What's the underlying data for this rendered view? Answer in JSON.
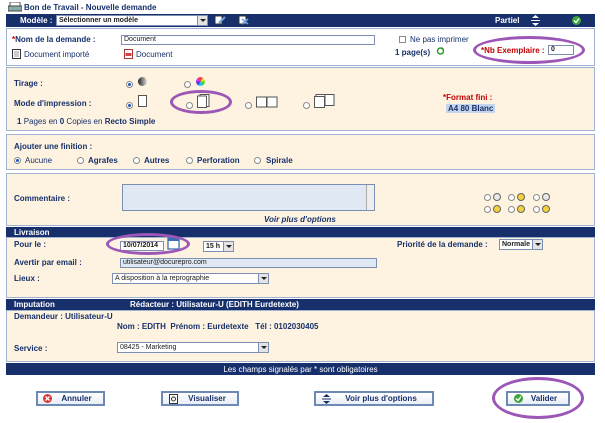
{
  "header": {
    "title": "Bon de Travail - Nouvelle demande",
    "modele_label": "Modèle :",
    "modele_value": "Sélectionner un modèle",
    "partiel_label": "Partiel"
  },
  "demande": {
    "nom_label": "Nom de la demande :",
    "nom_value": "Document",
    "ne_pas_imprimer_label": "Ne pas imprimer",
    "nb_exemplaire_label": "*Nb Exemplaire :",
    "nb_exemplaire_value": "0",
    "document_importe": "Document importé",
    "document_link": "Document",
    "pages": "1 page(s)"
  },
  "impression": {
    "tirage_label": "Tirage :",
    "mode_label": "Mode d'impression :",
    "format_fini_label": "*Format fini :",
    "format_fini_value": "A4 80 Blanc",
    "summary": {
      "pages_count": "1",
      "pages_text": "Pages en",
      "copies_count": "0",
      "copies_text": "Copies en",
      "mode": "Recto Simple"
    }
  },
  "finition": {
    "title": "Ajouter une finition :",
    "options": [
      "Aucune",
      "Agrafes",
      "Autres",
      "Perforation",
      "Spirale"
    ]
  },
  "commentaire": {
    "label": "Commentaire :",
    "voir_plus": "Voir plus d'options"
  },
  "livraison": {
    "title": "Livraison",
    "pour_le_label": "Pour le :",
    "date_value": "10/07/2014",
    "heure_value": "15 h",
    "priorite_label": "Priorité de la demande :",
    "priorite_value": "Normale",
    "avertir_label": "Avertir par email :",
    "email_value": "utilisateur@docurepro.com",
    "lieux_label": "Lieux :",
    "lieux_value": "A disposition à la reprographie"
  },
  "imputation": {
    "title": "Imputation",
    "redacteur": "Rédacteur : Utilisateur-U (EDITH Eurdetexte)",
    "demandeur": "Demandeur : Utilisateur-U",
    "nom_label": "Nom :",
    "nom_value": "EDITH",
    "prenom_label": "Prénom :",
    "prenom_value": "Eurdetexte",
    "tel_label": "Tél :",
    "tel_value": "0102030405",
    "service_label": "Service :",
    "service_value": "08425 - Marketing"
  },
  "footer": {
    "obligatoires": "Les champs signalés par * sont obligatoires"
  },
  "buttons": {
    "annuler": "Annuler",
    "visualiser": "Visualiser",
    "voir_plus": "Voir plus d'options",
    "valider": "Valider"
  },
  "colors": {
    "navy": "#17306b",
    "panel": "#fdf3e0",
    "highlight_oval": "#9c56b5",
    "link": "#1d58b6"
  }
}
